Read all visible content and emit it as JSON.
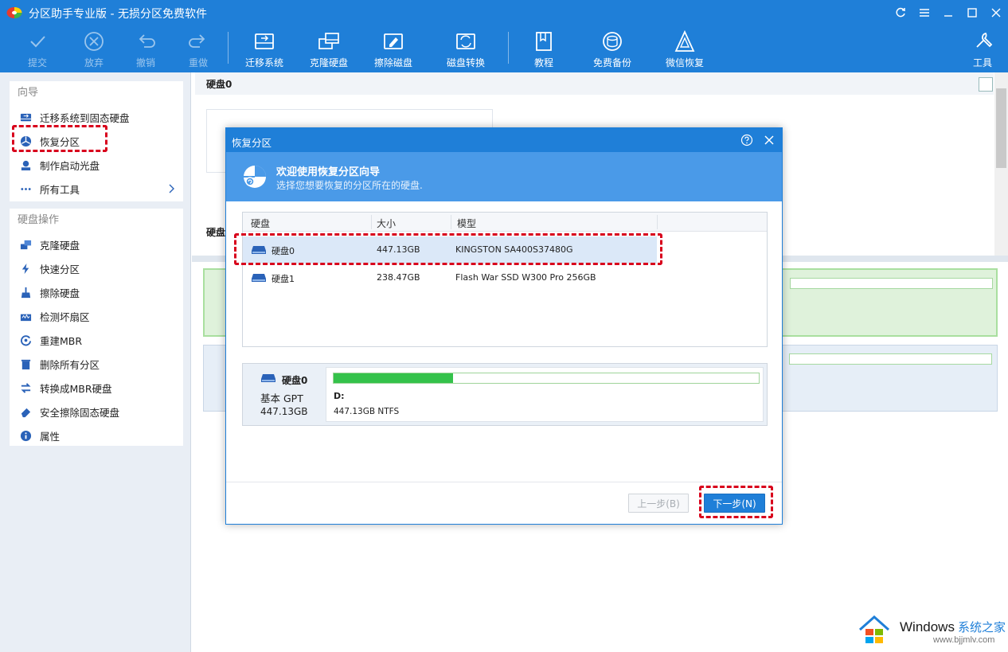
{
  "app": {
    "title": "分区助手专业版 - 无损分区免费软件"
  },
  "toolbar": {
    "items": [
      {
        "label": "提交",
        "icon": "check-icon"
      },
      {
        "label": "放弃",
        "icon": "discard-icon"
      },
      {
        "label": "撤销",
        "icon": "undo-icon"
      },
      {
        "label": "重做",
        "icon": "redo-icon"
      },
      {
        "label": "迁移系统",
        "icon": "migrate-os-icon"
      },
      {
        "label": "克隆硬盘",
        "icon": "clone-disk-icon"
      },
      {
        "label": "擦除磁盘",
        "icon": "wipe-disk-icon"
      },
      {
        "label": "磁盘转换",
        "icon": "disk-convert-icon"
      },
      {
        "label": "教程",
        "icon": "tutorial-icon"
      },
      {
        "label": "免费备份",
        "icon": "backup-icon"
      },
      {
        "label": "微信恢复",
        "icon": "wechat-restore-icon"
      },
      {
        "label": "工具",
        "icon": "tools-icon"
      }
    ]
  },
  "sidebar": {
    "wizard_title": "向导",
    "wizard_items": [
      {
        "label": "迁移系统到固态硬盘"
      },
      {
        "label": "恢复分区"
      },
      {
        "label": "制作启动光盘"
      },
      {
        "label": "所有工具"
      }
    ],
    "ops_title": "硬盘操作",
    "ops_items": [
      {
        "label": "克隆硬盘"
      },
      {
        "label": "快速分区"
      },
      {
        "label": "擦除硬盘"
      },
      {
        "label": "检测坏扇区"
      },
      {
        "label": "重建MBR"
      },
      {
        "label": "删除所有分区"
      },
      {
        "label": "转换成MBR硬盘"
      },
      {
        "label": "安全擦除固态硬盘"
      },
      {
        "label": "属性"
      }
    ]
  },
  "main": {
    "header": "硬盘0",
    "disk_label": "硬盘"
  },
  "dialog": {
    "title": "恢复分区",
    "banner_title": "欢迎使用恢复分区向导",
    "banner_subtitle": "选择您想要恢复的分区所在的硬盘.",
    "columns": [
      "硬盘",
      "大小",
      "模型"
    ],
    "disks": [
      {
        "name": "硬盘0",
        "size": "447.13GB",
        "model": "KINGSTON SA400S37480G",
        "selected": true
      },
      {
        "name": "硬盘1",
        "size": "238.47GB",
        "model": "Flash War SSD W300 Pro 256GB",
        "selected": false
      }
    ],
    "detail": {
      "name": "硬盘0",
      "type": "基本 GPT",
      "size": "447.13GB",
      "partition_letter": "D:",
      "partition_info": "447.13GB NTFS",
      "used_fraction": 0.28
    },
    "prev_button": "上一步(B)",
    "next_button": "下一步(N)"
  },
  "watermark": {
    "brand": "Windows",
    "brand_cn": "系统之家",
    "url": "www.bjjmlv.com"
  },
  "colors": {
    "accent": "#1f7fd8",
    "highlight": "#d8001c",
    "partition_green": "#34c24a"
  }
}
